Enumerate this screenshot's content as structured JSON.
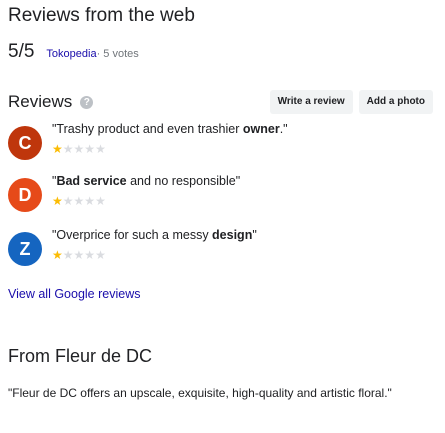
{
  "web_reviews": {
    "title": "Reviews from the web",
    "score": "5/5",
    "source": "Tokopedia",
    "votes": " · 5 votes"
  },
  "reviews": {
    "title": "Reviews",
    "help_icon": "help-circle-icon",
    "write_review_label": "Write a review",
    "add_photo_label": "Add a photo",
    "items": [
      {
        "initial": "C",
        "avatar_color": "#bf360c",
        "text_pre": "\"Trashy product and even trashier ",
        "text_bold": "owner",
        "text_post": ".\"",
        "rating": 1,
        "rating_max": 5
      },
      {
        "initial": "D",
        "avatar_color": "#e64a19",
        "text_pre": "\"",
        "text_bold": "Bad service",
        "text_post": " and no responsible\"",
        "rating": 1,
        "rating_max": 5
      },
      {
        "initial": "Z",
        "avatar_color": "#1565c0",
        "text_pre": "\"Overprice for such a messy ",
        "text_bold": "design",
        "text_post": "\"",
        "rating": 1,
        "rating_max": 5
      }
    ],
    "view_all_label": "View all Google reviews"
  },
  "from_owner": {
    "title": "From Fleur de DC",
    "description": "\"Fleur de DC offers an upscale, exquisite, high-quality and artistic floral.\""
  },
  "colors": {
    "link": "#1a0dab",
    "star_filled": "#fbbc04",
    "star_empty": "#dadce0"
  }
}
